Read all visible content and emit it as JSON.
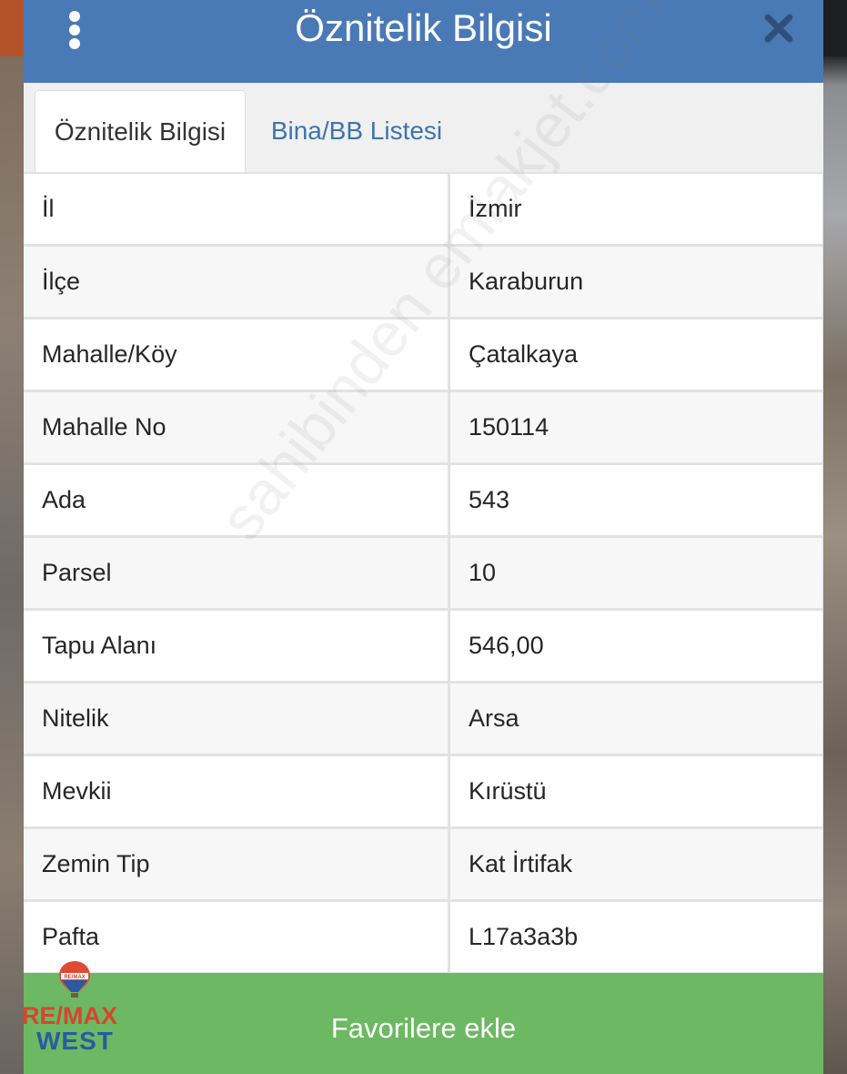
{
  "header": {
    "title": "Öznitelik Bilgisi"
  },
  "tabs": [
    {
      "label": "Öznitelik Bilgisi",
      "active": true
    },
    {
      "label": "Bina/BB Listesi",
      "active": false
    }
  ],
  "attributes": [
    {
      "label": "İl",
      "value": "İzmir"
    },
    {
      "label": "İlçe",
      "value": "Karaburun"
    },
    {
      "label": "Mahalle/Köy",
      "value": "Çatalkaya"
    },
    {
      "label": "Mahalle No",
      "value": "150114"
    },
    {
      "label": "Ada",
      "value": "543"
    },
    {
      "label": "Parsel",
      "value": "10"
    },
    {
      "label": "Tapu Alanı",
      "value": "546,00"
    },
    {
      "label": "Nitelik",
      "value": "Arsa"
    },
    {
      "label": "Mevkii",
      "value": "Kırüstü"
    },
    {
      "label": "Zemin Tip",
      "value": "Kat İrtifak"
    },
    {
      "label": "Pafta",
      "value": "L17a3a3b"
    }
  ],
  "watermark": "sahibinden emlakjet.com",
  "footer": {
    "favorite_label": "Favorilere ekle"
  },
  "logo": {
    "balloon_text": "RE/MAX",
    "brand": "RE/MAX",
    "office": "WEST"
  },
  "colors": {
    "header": "#4a7ab5",
    "tab_link": "#3d74ae",
    "favorite_button": "#6db862",
    "remax_red": "#d6452f",
    "remax_blue": "#2a5aa2"
  }
}
